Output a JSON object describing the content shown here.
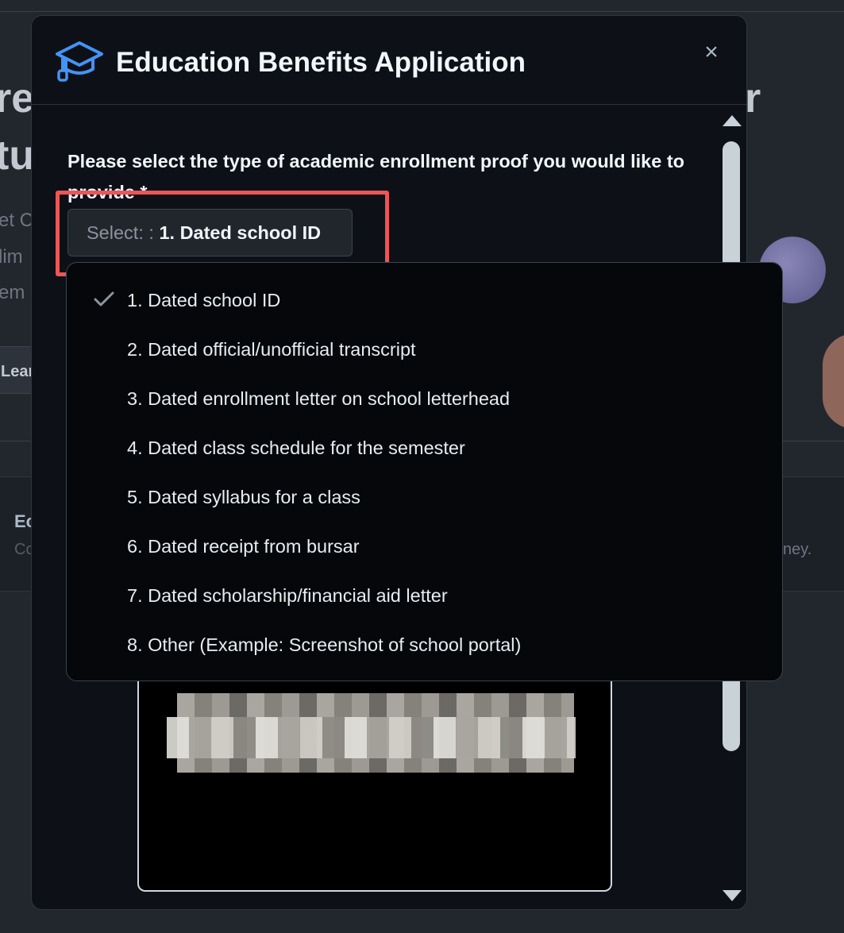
{
  "background": {
    "heading_line1": "re",
    "heading_line2": "tu",
    "heading_right": "r",
    "text_line1": "et C",
    "text_line2": "lim",
    "text_line3": "em",
    "learn_button": "Lear",
    "card_title": "Ec",
    "card_subtitle": "Co",
    "card_right_text": "ney."
  },
  "modal": {
    "title": "Education Benefits Application",
    "header_icon": "mortarboard-icon",
    "close_label": "×",
    "question": "Please select the type of academic enrollment proof you would like to provide *",
    "select": {
      "prefix": "Select: : ",
      "value": "1. Dated school ID"
    }
  },
  "dropdown": {
    "selected_index": 0,
    "options": [
      "1. Dated school ID",
      "2. Dated official/unofficial transcript",
      "3. Dated enrollment letter on school letterhead",
      "4. Dated class schedule for the semester",
      "5. Dated syllabus for a class",
      "6. Dated receipt from bursar",
      "7. Dated scholarship/financial aid letter",
      "8. Other (Example: Screenshot of school portal)"
    ]
  },
  "colors": {
    "accent_icon": "#4493f8",
    "highlight": "#f05454",
    "modal_bg": "#0d1117"
  }
}
